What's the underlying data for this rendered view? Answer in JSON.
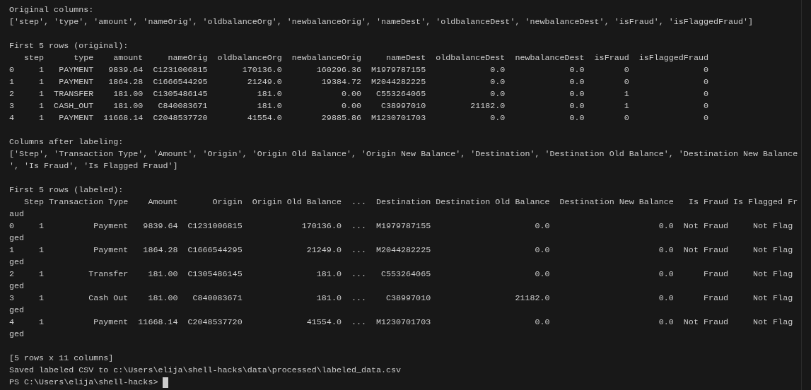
{
  "blocks": [
    [
      "Original columns:",
      "['step', 'type', 'amount', 'nameOrig', 'oldbalanceOrg', 'newbalanceOrig', 'nameDest', 'oldbalanceDest', 'newbalanceDest', 'isFraud', 'isFlaggedFraud']"
    ],
    [
      "First 5 rows (original):",
      "   step      type    amount     nameOrig  oldbalanceOrg  newbalanceOrig     nameDest  oldbalanceDest  newbalanceDest  isFraud  isFlaggedFraud",
      "0     1   PAYMENT   9839.64  C1231006815       170136.0       160296.36  M1979787155             0.0             0.0        0               0",
      "1     1   PAYMENT   1864.28  C1666544295        21249.0        19384.72  M2044282225             0.0             0.0        0               0",
      "2     1  TRANSFER    181.00  C1305486145          181.0            0.00   C553264065             0.0             0.0        1               0",
      "3     1  CASH_OUT    181.00   C840083671          181.0            0.00    C38997010         21182.0             0.0        1               0",
      "4     1   PAYMENT  11668.14  C2048537720        41554.0        29885.86  M1230701703             0.0             0.0        0               0"
    ],
    [
      "Columns after labeling:",
      "['Step', 'Transaction Type', 'Amount', 'Origin', 'Origin Old Balance', 'Origin New Balance', 'Destination', 'Destination Old Balance', 'Destination New Balance",
      "', 'Is Fraud', 'Is Flagged Fraud']"
    ],
    [
      "First 5 rows (labeled):",
      "   Step Transaction Type    Amount       Origin  Origin Old Balance  ...  Destination Destination Old Balance  Destination New Balance   Is Fraud Is Flagged Fr",
      "aud",
      "0     1          Payment   9839.64  C1231006815            170136.0  ...  M1979787155                     0.0                      0.0  Not Fraud     Not Flag",
      "ged",
      "1     1          Payment   1864.28  C1666544295             21249.0  ...  M2044282225                     0.0                      0.0  Not Fraud     Not Flag",
      "ged",
      "2     1         Transfer    181.00  C1305486145               181.0  ...   C553264065                     0.0                      0.0      Fraud     Not Flag",
      "ged",
      "3     1         Cash Out    181.00   C840083671               181.0  ...    C38997010                 21182.0                      0.0      Fraud     Not Flag",
      "ged",
      "4     1          Payment  11668.14  C2048537720             41554.0  ...  M1230701703                     0.0                      0.0  Not Fraud     Not Flag",
      "ged"
    ],
    [
      "[5 rows x 11 columns]",
      "Saved labeled CSV to c:\\Users\\elija\\shell-hacks\\data\\processed\\labeled_data.csv"
    ]
  ],
  "prompt": {
    "text": "PS C:\\Users\\elija\\shell-hacks> ",
    "cursor": true
  }
}
